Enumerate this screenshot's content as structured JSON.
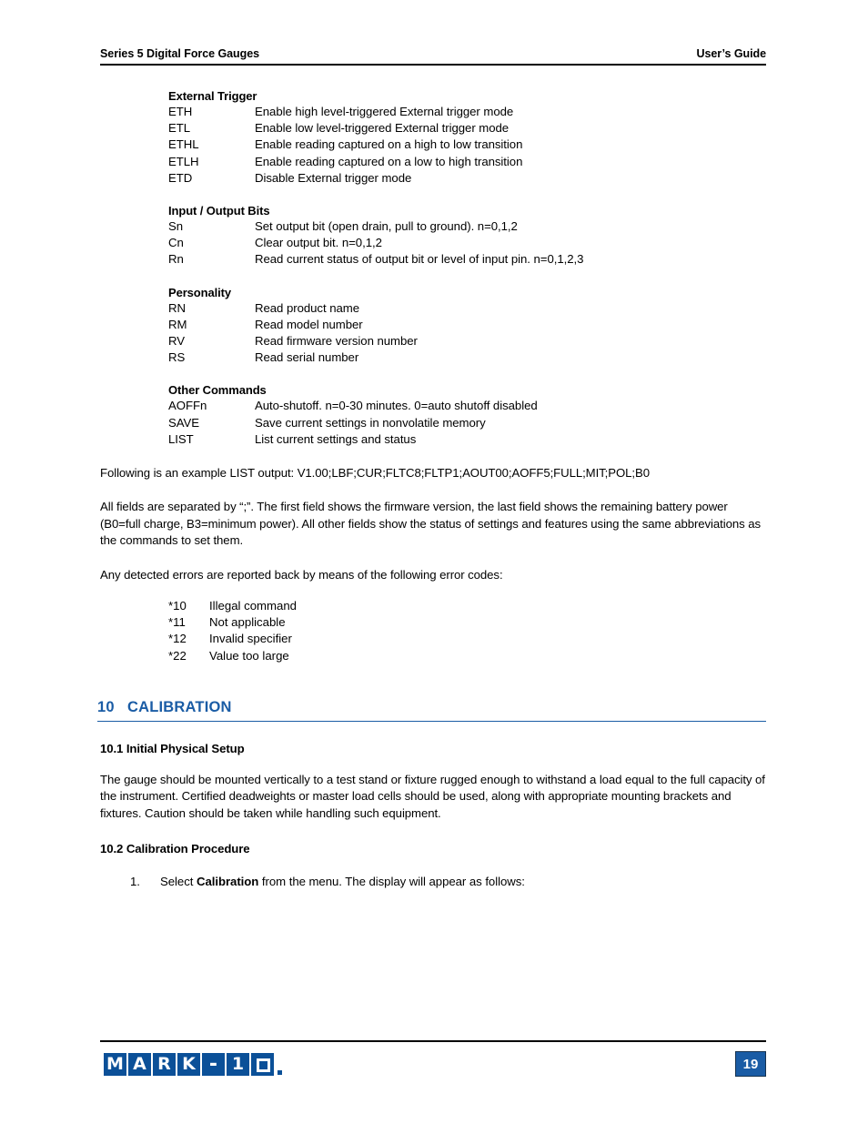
{
  "header": {
    "left": "Series 5 Digital Force Gauges",
    "right": "User’s Guide"
  },
  "command_groups": [
    {
      "title": "External Trigger",
      "rows": [
        {
          "cmd": "ETH",
          "desc": "Enable high level-triggered External trigger mode"
        },
        {
          "cmd": "ETL",
          "desc": "Enable low level-triggered External trigger mode"
        },
        {
          "cmd": "ETHL",
          "desc": "Enable reading captured on a high to low transition"
        },
        {
          "cmd": "ETLH",
          "desc": "Enable reading captured on a low to high transition"
        },
        {
          "cmd": "ETD",
          "desc": "Disable External trigger mode"
        }
      ]
    },
    {
      "title": "Input / Output Bits",
      "rows": [
        {
          "cmd": "Sn",
          "desc": "Set output bit (open drain, pull to ground). n=0,1,2"
        },
        {
          "cmd": "Cn",
          "desc": "Clear output bit. n=0,1,2"
        },
        {
          "cmd": "Rn",
          "desc": "Read current status of output bit or level of input pin. n=0,1,2,3"
        }
      ]
    },
    {
      "title": "Personality",
      "rows": [
        {
          "cmd": "RN",
          "desc": "Read product name"
        },
        {
          "cmd": "RM",
          "desc": "Read model number"
        },
        {
          "cmd": "RV",
          "desc": "Read firmware version number"
        },
        {
          "cmd": "RS",
          "desc": "Read serial number"
        }
      ]
    },
    {
      "title": "Other Commands",
      "rows": [
        {
          "cmd": "AOFFn",
          "desc": "Auto-shutoff. n=0-30 minutes. 0=auto shutoff disabled"
        },
        {
          "cmd": "SAVE",
          "desc": "Save current settings in nonvolatile memory"
        },
        {
          "cmd": "LIST",
          "desc": "List current settings and status"
        }
      ]
    }
  ],
  "paragraphs": {
    "list_example": "Following is an example LIST output: V1.00;LBF;CUR;FLTC8;FLTP1;AOUT00;AOFF5;FULL;MIT;POL;B0",
    "fields_explained": "All fields are separated by “;”. The first field shows the firmware version, the last field shows the remaining battery power (B0=full charge, B3=minimum power). All other fields show the status of settings and features using the same abbreviations as the commands to set them.",
    "errors_intro": "Any detected errors are reported back by means of the following error codes:"
  },
  "error_codes": [
    {
      "code": "*10",
      "desc": "Illegal command"
    },
    {
      "code": "*11",
      "desc": "Not applicable"
    },
    {
      "code": "*12",
      "desc": "Invalid specifier"
    },
    {
      "code": "*22",
      "desc": "Value too large"
    }
  ],
  "chapter": {
    "number": "10",
    "title": "CALIBRATION",
    "color": "#1a5ca5"
  },
  "sections": {
    "s101_head": "10.1 Initial Physical Setup",
    "s101_body": "The gauge should be mounted vertically to a test stand or fixture rugged enough to withstand a load equal to the full capacity of the instrument. Certified deadweights or master load cells should be used, along with appropriate mounting brackets and fixtures. Caution should be taken while handling such equipment.",
    "s102_head": "10.2 Calibration Procedure",
    "step1_marker": "1.",
    "step1_prefix": "Select ",
    "step1_bold": "Calibration",
    "step1_suffix": " from the menu. The display will appear as follows:"
  },
  "footer": {
    "logo_letters": [
      "M",
      "A",
      "R",
      "K",
      "-",
      "1",
      "0"
    ],
    "page_number": "19",
    "logo_color": "#0b5098",
    "badge_color": "#1a5ca5"
  }
}
